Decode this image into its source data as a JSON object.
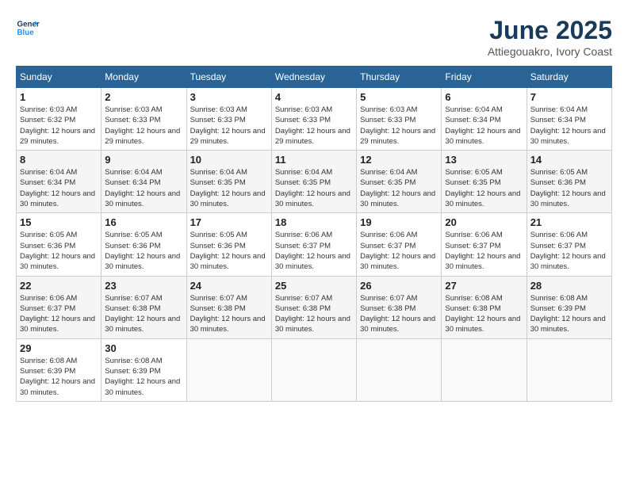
{
  "header": {
    "logo_line1": "General",
    "logo_line2": "Blue",
    "title": "June 2025",
    "subtitle": "Attiegouakro, Ivory Coast"
  },
  "calendar": {
    "days_of_week": [
      "Sunday",
      "Monday",
      "Tuesday",
      "Wednesday",
      "Thursday",
      "Friday",
      "Saturday"
    ],
    "weeks": [
      [
        {
          "day": "",
          "empty": true
        },
        {
          "day": "",
          "empty": true
        },
        {
          "day": "",
          "empty": true
        },
        {
          "day": "",
          "empty": true
        },
        {
          "day": "",
          "empty": true
        },
        {
          "day": "",
          "empty": true
        },
        {
          "day": "",
          "empty": true
        }
      ]
    ],
    "cells": [
      {
        "date": "1",
        "sunrise": "6:03 AM",
        "sunset": "6:32 PM",
        "daylight": "12 hours and 29 minutes."
      },
      {
        "date": "2",
        "sunrise": "6:03 AM",
        "sunset": "6:33 PM",
        "daylight": "12 hours and 29 minutes."
      },
      {
        "date": "3",
        "sunrise": "6:03 AM",
        "sunset": "6:33 PM",
        "daylight": "12 hours and 29 minutes."
      },
      {
        "date": "4",
        "sunrise": "6:03 AM",
        "sunset": "6:33 PM",
        "daylight": "12 hours and 29 minutes."
      },
      {
        "date": "5",
        "sunrise": "6:03 AM",
        "sunset": "6:33 PM",
        "daylight": "12 hours and 29 minutes."
      },
      {
        "date": "6",
        "sunrise": "6:04 AM",
        "sunset": "6:34 PM",
        "daylight": "12 hours and 30 minutes."
      },
      {
        "date": "7",
        "sunrise": "6:04 AM",
        "sunset": "6:34 PM",
        "daylight": "12 hours and 30 minutes."
      },
      {
        "date": "8",
        "sunrise": "6:04 AM",
        "sunset": "6:34 PM",
        "daylight": "12 hours and 30 minutes."
      },
      {
        "date": "9",
        "sunrise": "6:04 AM",
        "sunset": "6:34 PM",
        "daylight": "12 hours and 30 minutes."
      },
      {
        "date": "10",
        "sunrise": "6:04 AM",
        "sunset": "6:35 PM",
        "daylight": "12 hours and 30 minutes."
      },
      {
        "date": "11",
        "sunrise": "6:04 AM",
        "sunset": "6:35 PM",
        "daylight": "12 hours and 30 minutes."
      },
      {
        "date": "12",
        "sunrise": "6:04 AM",
        "sunset": "6:35 PM",
        "daylight": "12 hours and 30 minutes."
      },
      {
        "date": "13",
        "sunrise": "6:05 AM",
        "sunset": "6:35 PM",
        "daylight": "12 hours and 30 minutes."
      },
      {
        "date": "14",
        "sunrise": "6:05 AM",
        "sunset": "6:36 PM",
        "daylight": "12 hours and 30 minutes."
      },
      {
        "date": "15",
        "sunrise": "6:05 AM",
        "sunset": "6:36 PM",
        "daylight": "12 hours and 30 minutes."
      },
      {
        "date": "16",
        "sunrise": "6:05 AM",
        "sunset": "6:36 PM",
        "daylight": "12 hours and 30 minutes."
      },
      {
        "date": "17",
        "sunrise": "6:05 AM",
        "sunset": "6:36 PM",
        "daylight": "12 hours and 30 minutes."
      },
      {
        "date": "18",
        "sunrise": "6:06 AM",
        "sunset": "6:37 PM",
        "daylight": "12 hours and 30 minutes."
      },
      {
        "date": "19",
        "sunrise": "6:06 AM",
        "sunset": "6:37 PM",
        "daylight": "12 hours and 30 minutes."
      },
      {
        "date": "20",
        "sunrise": "6:06 AM",
        "sunset": "6:37 PM",
        "daylight": "12 hours and 30 minutes."
      },
      {
        "date": "21",
        "sunrise": "6:06 AM",
        "sunset": "6:37 PM",
        "daylight": "12 hours and 30 minutes."
      },
      {
        "date": "22",
        "sunrise": "6:06 AM",
        "sunset": "6:37 PM",
        "daylight": "12 hours and 30 minutes."
      },
      {
        "date": "23",
        "sunrise": "6:07 AM",
        "sunset": "6:38 PM",
        "daylight": "12 hours and 30 minutes."
      },
      {
        "date": "24",
        "sunrise": "6:07 AM",
        "sunset": "6:38 PM",
        "daylight": "12 hours and 30 minutes."
      },
      {
        "date": "25",
        "sunrise": "6:07 AM",
        "sunset": "6:38 PM",
        "daylight": "12 hours and 30 minutes."
      },
      {
        "date": "26",
        "sunrise": "6:07 AM",
        "sunset": "6:38 PM",
        "daylight": "12 hours and 30 minutes."
      },
      {
        "date": "27",
        "sunrise": "6:08 AM",
        "sunset": "6:38 PM",
        "daylight": "12 hours and 30 minutes."
      },
      {
        "date": "28",
        "sunrise": "6:08 AM",
        "sunset": "6:39 PM",
        "daylight": "12 hours and 30 minutes."
      },
      {
        "date": "29",
        "sunrise": "6:08 AM",
        "sunset": "6:39 PM",
        "daylight": "12 hours and 30 minutes."
      },
      {
        "date": "30",
        "sunrise": "6:08 AM",
        "sunset": "6:39 PM",
        "daylight": "12 hours and 30 minutes."
      }
    ]
  }
}
